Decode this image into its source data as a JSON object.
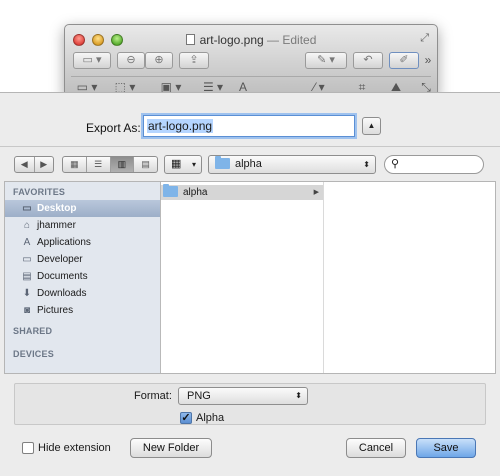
{
  "window": {
    "title": "art-logo.png",
    "edited": "— Edited"
  },
  "sheet": {
    "export_label": "Export As:",
    "filename": "art-logo.png",
    "location": "alpha",
    "search_placeholder": ""
  },
  "sidebar": {
    "favorites_header": "FAVORITES",
    "shared_header": "SHARED",
    "devices_header": "DEVICES",
    "items": [
      {
        "label": "Desktop",
        "icon": "desktop-icon"
      },
      {
        "label": "jhammer",
        "icon": "home-icon"
      },
      {
        "label": "Applications",
        "icon": "applications-icon"
      },
      {
        "label": "Developer",
        "icon": "folder-icon"
      },
      {
        "label": "Documents",
        "icon": "documents-icon"
      },
      {
        "label": "Downloads",
        "icon": "downloads-icon"
      },
      {
        "label": "Pictures",
        "icon": "pictures-icon"
      }
    ]
  },
  "browser": {
    "column1_items": [
      "alpha"
    ]
  },
  "options": {
    "format_label": "Format:",
    "format_value": "PNG",
    "alpha_label": "Alpha",
    "alpha_checked": true
  },
  "footer": {
    "hide_extension_label": "Hide extension",
    "hide_extension_checked": false,
    "new_folder_label": "New Folder",
    "cancel_label": "Cancel",
    "save_label": "Save"
  },
  "colors": {
    "accent": "#6ea6e8",
    "sidebar_bg": "#e2e7ee",
    "selection": "#9dafc8"
  }
}
